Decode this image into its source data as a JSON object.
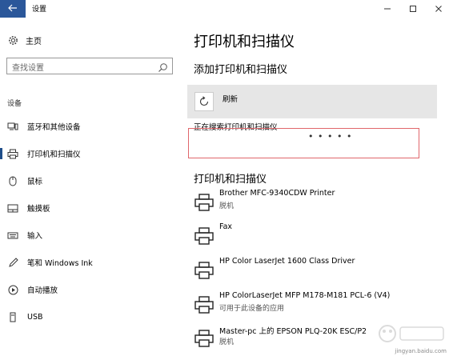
{
  "window": {
    "title": "设置",
    "back_icon": "arrow-left-icon",
    "minimize_icon": "minimize-icon",
    "maximize_icon": "maximize-icon",
    "close_icon": "close-icon",
    "accent": "#2b579a"
  },
  "sidebar": {
    "home_label": "主页",
    "search_placeholder": "查找设置",
    "section_label": "设备",
    "items": [
      {
        "label": "蓝牙和其他设备",
        "icon": "bluetooth-devices-icon",
        "active": false
      },
      {
        "label": "打印机和扫描仪",
        "icon": "printer-icon",
        "active": true
      },
      {
        "label": "鼠标",
        "icon": "mouse-icon",
        "active": false
      },
      {
        "label": "触摸板",
        "icon": "touchpad-icon",
        "active": false
      },
      {
        "label": "输入",
        "icon": "keyboard-icon",
        "active": false
      },
      {
        "label": "笔和 Windows Ink",
        "icon": "pen-icon",
        "active": false
      },
      {
        "label": "自动播放",
        "icon": "autoplay-icon",
        "active": false
      },
      {
        "label": "USB",
        "icon": "usb-icon",
        "active": false
      }
    ]
  },
  "main": {
    "page_title": "打印机和扫描仪",
    "add_title": "添加打印机和扫描仪",
    "refresh_label": "刷新",
    "searching_text": "正在搜索打印机和扫描仪",
    "progress_dots": "• • • • •",
    "list_title": "打印机和扫描仪",
    "printers": [
      {
        "name": "Brother MFC-9340CDW Printer",
        "status": "脱机"
      },
      {
        "name": "Fax",
        "status": ""
      },
      {
        "name": "HP Color LaserJet 1600 Class Driver",
        "status": ""
      },
      {
        "name": "HP ColorLaserJet MFP M178-M181 PCL-6 (V4)",
        "status": "可用于此设备的应用"
      },
      {
        "name": "Master-pc 上的 EPSON PLQ-20K ESC/P2",
        "status": "脱机"
      }
    ]
  },
  "watermark": {
    "text": "jingyan.baidu.com"
  }
}
